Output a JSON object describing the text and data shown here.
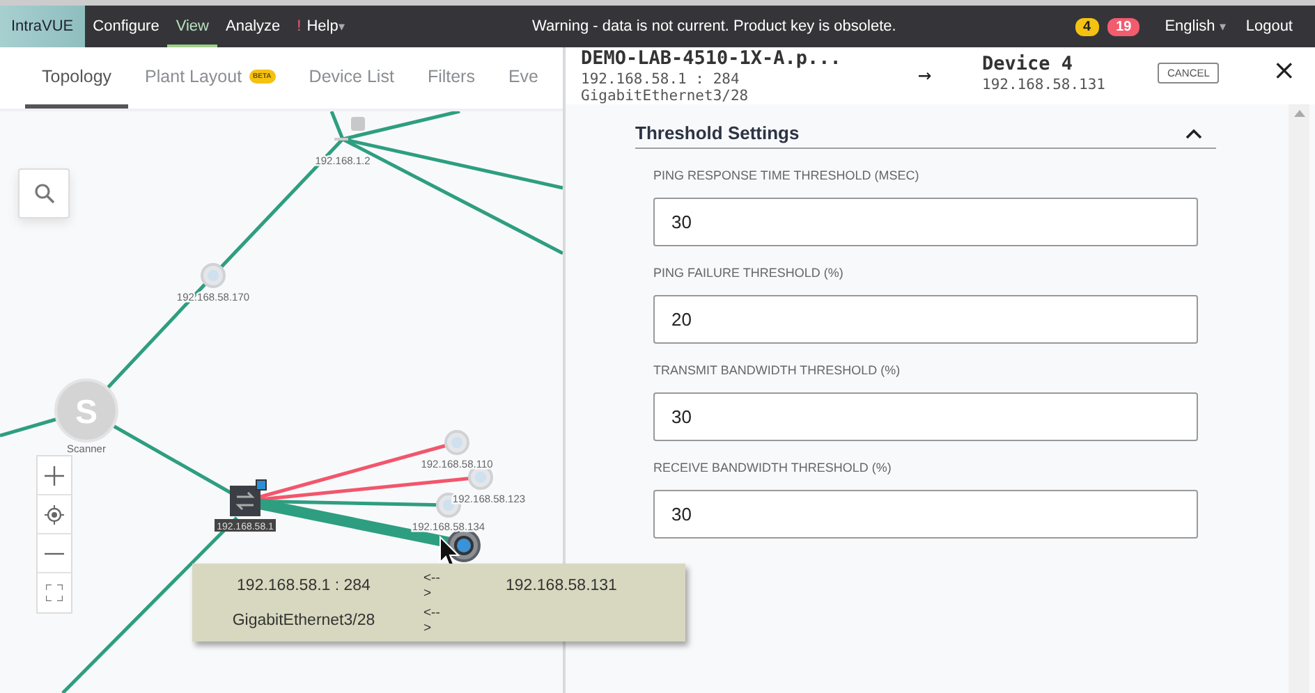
{
  "topbar": {
    "logo": "IntraVUE",
    "menu": [
      {
        "label": "Configure",
        "selected": false
      },
      {
        "label": "View",
        "selected": true
      },
      {
        "label": "Analyze",
        "selected": false
      },
      {
        "label": "Help",
        "selected": false,
        "mark": "!",
        "caret": "▾"
      }
    ],
    "warning": "Warning - data is not current. Product key is obsolete.",
    "badges": [
      {
        "count": "4",
        "color": "#f5c211"
      },
      {
        "count": "19",
        "color": "#f25c6e"
      }
    ],
    "language": "English",
    "language_caret": "▾",
    "logout": "Logout"
  },
  "tabs": [
    {
      "label": "Topology",
      "selected": true
    },
    {
      "label": "Plant Layout",
      "selected": false,
      "badge": "BETA"
    },
    {
      "label": "Device List",
      "selected": false
    },
    {
      "label": "Filters",
      "selected": false
    },
    {
      "label": "Eve",
      "selected": false
    }
  ],
  "topology": {
    "nodes": [
      {
        "kind": "hub",
        "label": "192.168.1.2"
      },
      {
        "kind": "device",
        "label": "192.168.58.170"
      },
      {
        "kind": "scanner",
        "label": "Scanner",
        "letter": "S"
      },
      {
        "kind": "switch",
        "label": "192.168.58.1"
      },
      {
        "kind": "device",
        "label": "192.168.58.110"
      },
      {
        "kind": "device",
        "label": "192.168.58.123"
      },
      {
        "kind": "device",
        "label": "192.168.58.134"
      },
      {
        "kind": "selected"
      }
    ],
    "links": [
      {
        "color": "#2e9e80",
        "selected": false
      },
      {
        "color": "#2e9e80",
        "selected": false
      },
      {
        "color": "#2e9e80",
        "selected": false
      },
      {
        "color": "#f2566b",
        "selected": false
      },
      {
        "color": "#f2566b",
        "selected": false
      },
      {
        "color": "#2e9e80",
        "selected": false
      },
      {
        "color": "#2e9e80",
        "selected": true
      }
    ],
    "tooltip": {
      "rows": [
        {
          "source": "192.168.58.1 : 284",
          "arrow": "<-->",
          "target": "192.168.58.131"
        },
        {
          "source": "GigabitEthernet3/28",
          "arrow": "<-->"
        }
      ]
    }
  },
  "panel": {
    "source": {
      "name": "DEMO-LAB-4510-1X-A.p...",
      "address": "192.168.58.1 : 284",
      "port": "GigabitEthernet3/28"
    },
    "arrow": "→",
    "target": {
      "name": "Device 4",
      "address": "192.168.58.131"
    },
    "cancel": "CANCEL",
    "close": "×",
    "section": {
      "title": "Threshold Settings",
      "expanded": true,
      "fields": [
        {
          "label": "PING RESPONSE TIME THRESHOLD (MSEC)",
          "value": "30"
        },
        {
          "label": "PING FAILURE THRESHOLD (%)",
          "value": "20"
        },
        {
          "label": "TRANSMIT BANDWIDTH THRESHOLD (%)",
          "value": "30"
        },
        {
          "label": "RECEIVE BANDWIDTH THRESHOLD (%)",
          "value": "30"
        }
      ]
    }
  }
}
